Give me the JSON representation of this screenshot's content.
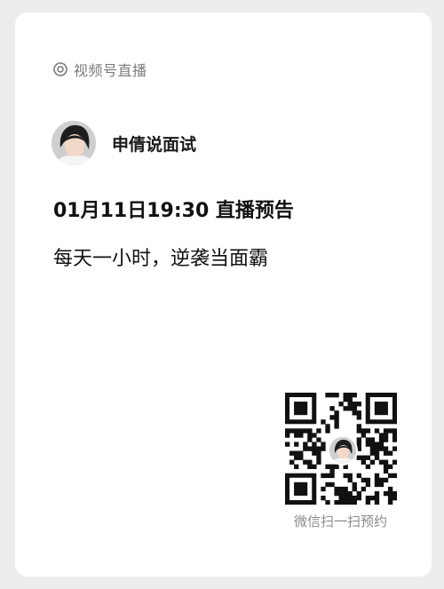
{
  "header": {
    "icon": "live-broadcast-icon",
    "label": "视频号直播"
  },
  "author": {
    "name": "申倩说面试"
  },
  "announcement": {
    "title": "01月11日19:30 直播预告",
    "subtitle": "每天一小时，逆袭当面霸"
  },
  "qr": {
    "caption": "微信扫一扫预约"
  }
}
